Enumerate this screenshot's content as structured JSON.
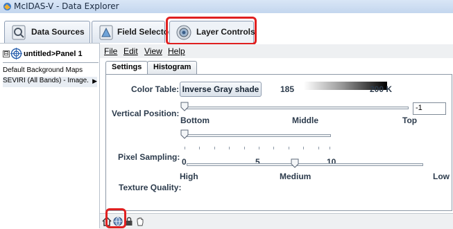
{
  "window": {
    "title": "McIDAS-V - Data Explorer"
  },
  "top_tabs": [
    {
      "label": "Data Sources",
      "icon": "data-sources-icon"
    },
    {
      "label": "Field Selector",
      "icon": "field-selector-icon"
    },
    {
      "label": "Layer Controls",
      "icon": "layer-controls-icon",
      "selected": true
    }
  ],
  "left_panel": {
    "root_label": "untitled>Panel 1",
    "expander": "⊟",
    "items": [
      "Default Background Maps",
      "SEVIRI (All Bands) - Image."
    ]
  },
  "menubar": [
    "File",
    "Edit",
    "View",
    "Help"
  ],
  "sub_tabs": [
    "Settings",
    "Histogram"
  ],
  "settings": {
    "color_table": {
      "label": "Color Table:",
      "button": "Inverse Gray shade",
      "min": "185",
      "max": "200 K"
    },
    "vertical_position": {
      "label": "Vertical Position:",
      "min_label": "Bottom",
      "mid_label": "Middle",
      "max_label": "Top",
      "value": "-1",
      "slider_fraction": 0.0
    },
    "pixel_sampling": {
      "label": "Pixel Sampling:",
      "ticks": [
        "0",
        "5",
        "10"
      ],
      "slider_value": 0
    },
    "texture_quality": {
      "label": "Texture Quality:",
      "min_label": "High",
      "mid_label": "Medium",
      "max_label": "Low",
      "slider_fraction": 0.5
    }
  },
  "colors": {
    "highlight": "#e02020"
  }
}
